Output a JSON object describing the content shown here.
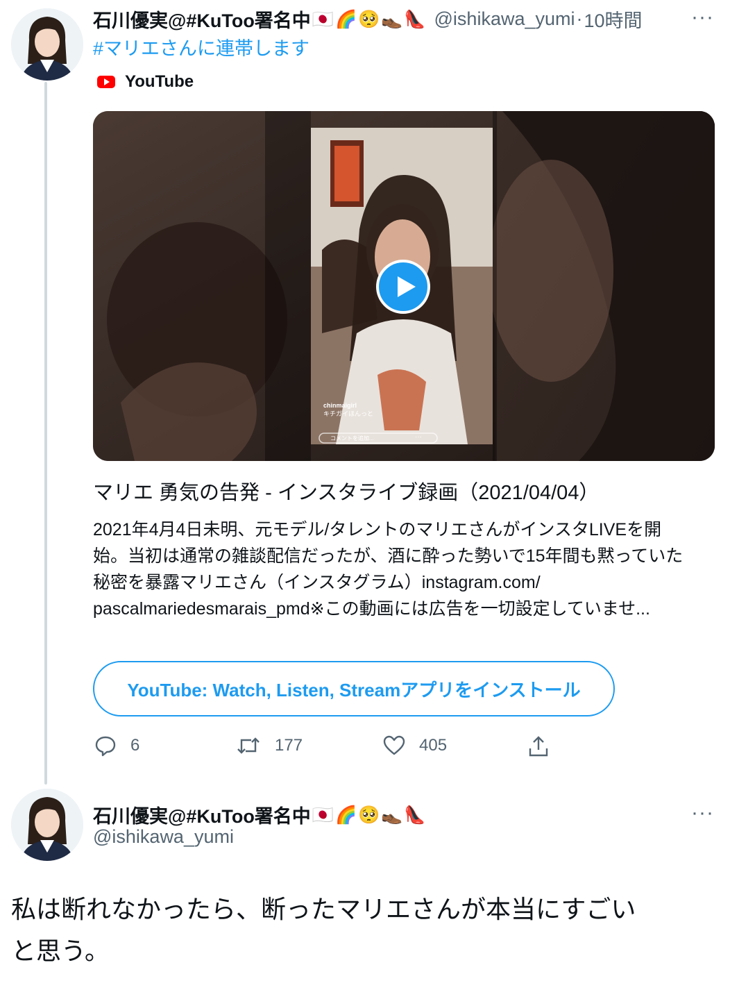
{
  "tweet1": {
    "display_name": "石川優実@#KuToo署名中",
    "emojis": [
      "🇯🇵",
      "🌈",
      "🥺",
      "👞",
      "👠"
    ],
    "handle": "@ishikawa_yumi",
    "separator": "·",
    "time": "10時間",
    "more": "···",
    "hashtag": "#マリエさんに連帯します",
    "media_source": "YouTube",
    "video_overlay": {
      "comment1_user": "chinmaigirl",
      "comment1_text": "キチガイほんっと",
      "comment_placeholder": "コメントを追加...",
      "dots": "···"
    },
    "card": {
      "title": "マリエ 勇気の告発 - インスタライブ録画（2021/04/04）",
      "description_lines": [
        "2021年4月4日未明、元モデル/タレントのマリエさんがインスタLIVEを開",
        "始。当初は通常の雑談配信だったが、酒に酔った勢いで15年間も黙っていた",
        "秘密を暴露マリエさん（インスタグラム）instagram.com/",
        "pascalmariedesmarais_pmd※この動画には広告を一切設定していませ..."
      ]
    },
    "install_button": "YouTube: Watch, Listen, Streamアプリをインストール",
    "actions": {
      "reply_count": "6",
      "retweet_count": "177",
      "like_count": "405"
    }
  },
  "tweet2": {
    "display_name": "石川優実@#KuToo署名中",
    "emojis": [
      "🇯🇵",
      "🌈",
      "🥺",
      "👞",
      "👠"
    ],
    "handle": "@ishikawa_yumi",
    "more": "···",
    "text_lines": [
      "私は断れなかったら、断ったマリエさんが本当にすごい",
      "と思う。"
    ]
  },
  "colors": {
    "link_blue": "#1d9bf0",
    "secondary_gray": "#536471",
    "youtube_red": "#ff0000"
  }
}
